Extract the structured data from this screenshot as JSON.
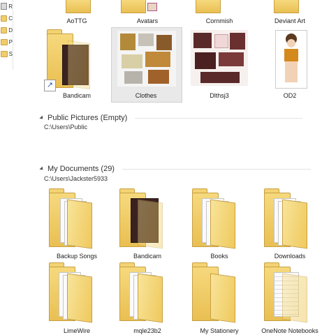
{
  "sidebar": {
    "items": [
      {
        "label": "R",
        "icon": "library-icon"
      },
      {
        "label": "C",
        "icon": "folder-icon"
      },
      {
        "label": "D",
        "icon": "folder-icon"
      },
      {
        "label": "P",
        "icon": "folder-icon"
      },
      {
        "label": "S",
        "icon": "folder-icon"
      }
    ]
  },
  "top_row": {
    "labels": [
      "AoTTG",
      "Avatars",
      "Cornmish",
      "Deviant Art"
    ]
  },
  "row2": {
    "items": [
      {
        "label": "Bandicam",
        "icon": "folder-icon",
        "shortcut": true
      },
      {
        "label": "Clothes",
        "icon": "image-icon",
        "selected": true
      },
      {
        "label": "Dlthsj3",
        "icon": "image-icon"
      },
      {
        "label": "OD2",
        "icon": "image-icon"
      }
    ]
  },
  "sections": {
    "public": {
      "title": "Public Pictures (Empty)",
      "path": "C:\\Users\\Public"
    },
    "docs": {
      "title": "My Documents (29)",
      "path": "C:\\Users\\Jackster5933"
    }
  },
  "docs_row1": {
    "items": [
      {
        "label": "Backup Songs"
      },
      {
        "label": "Bandicam"
      },
      {
        "label": "Books"
      },
      {
        "label": "Downloads"
      }
    ]
  },
  "docs_row2": {
    "items": [
      {
        "label": "LimeWire"
      },
      {
        "label": "mqle23b2"
      },
      {
        "label": "My Stationery"
      },
      {
        "label": "OneNote Notebooks"
      }
    ]
  },
  "colors": {
    "folder": "#f1cd6a",
    "selection": "#e9e9e9"
  }
}
